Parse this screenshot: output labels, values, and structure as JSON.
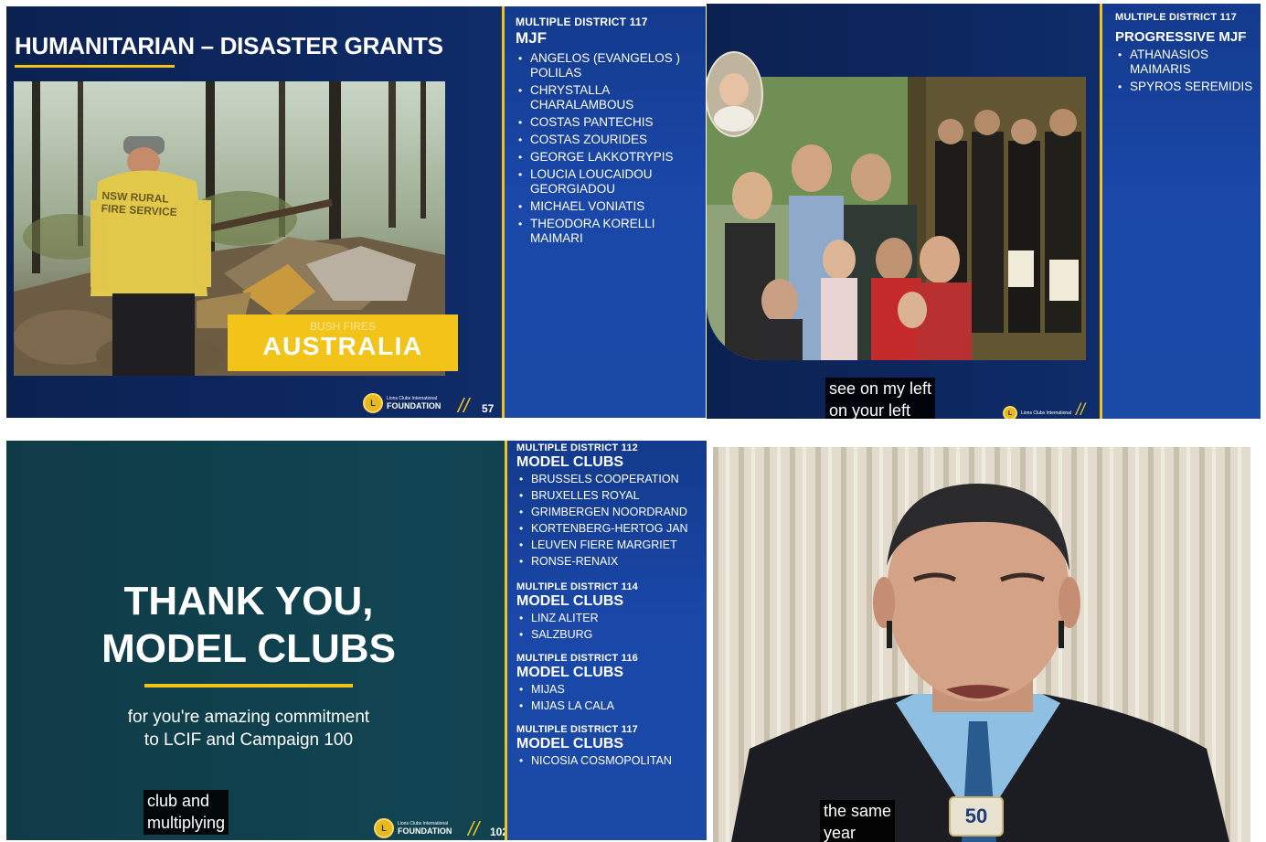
{
  "panel1": {
    "title": "HUMANITARIAN – DISASTER GRANTS",
    "photo_vest_line1": "NSW RURAL",
    "photo_vest_line2": "FIRE SERVICE",
    "banner_small": "BUSH FIRES",
    "banner_big": "AUSTRALIA",
    "footer_small": "Lions Clubs International",
    "footer_big": "FOUNDATION",
    "page_number": "57",
    "sidebar": {
      "district": "MULTIPLE DISTRICT 117",
      "heading": "MJF",
      "names": [
        "ANGELOS (EVANGELOS ) POLILAS",
        "CHRYSTALLA CHARALAMBOUS",
        "COSTAS PANTECHIS",
        "COSTAS ZOURIDES",
        "GEORGE LAKKOTRYPIS",
        "LOUCIA LOUCAIDOU GEORGIADOU",
        "MICHAEL VONIATIS",
        "THEODORA KORELLI MAIMARI"
      ]
    }
  },
  "panel2": {
    "caption_line1": "see on my left",
    "caption_line2": "on your left",
    "footer_small": "Lions Clubs International",
    "sidebar": {
      "district": "MULTIPLE DISTRICT 117",
      "heading": "PROGRESSIVE MJF",
      "names": [
        "ATHANASIOS MAIMARIS",
        "SPYROS SEREMIDIS"
      ]
    }
  },
  "panel3": {
    "title_line1": "THANK YOU,",
    "title_line2": "MODEL CLUBS",
    "subtitle_line1": "for you're amazing commitment",
    "subtitle_line2": "to LCIF and Campaign 100",
    "caption_line1": "club and",
    "caption_line2": "multiplying",
    "footer_small": "Lions Clubs International",
    "footer_big": "FOUNDATION",
    "page_number": "102",
    "sidebar": [
      {
        "district": "MULTIPLE DISTRICT 112",
        "heading": "MODEL CLUBS",
        "names": [
          "BRUSSELS COOPERATION",
          "BRUXELLES ROYAL",
          "GRIMBERGEN NOORDRAND",
          "KORTENBERG-HERTOG JAN",
          "LEUVEN FIERE MARGRIET",
          "RONSE-RENAIX"
        ]
      },
      {
        "district": "MULTIPLE DISTRICT 114",
        "heading": "MODEL CLUBS",
        "names": [
          "LINZ ALITER",
          "SALZBURG"
        ]
      },
      {
        "district": "MULTIPLE DISTRICT 116",
        "heading": "MODEL CLUBS",
        "names": [
          "MIJAS",
          "MIJAS LA CALA"
        ]
      },
      {
        "district": "MULTIPLE DISTRICT 117",
        "heading": "MODEL CLUBS",
        "names": [
          "NICOSIA COSMOPOLITAN"
        ]
      }
    ]
  },
  "panel4": {
    "caption_line1": "the same",
    "caption_line2": "year",
    "badge_text": "50"
  }
}
